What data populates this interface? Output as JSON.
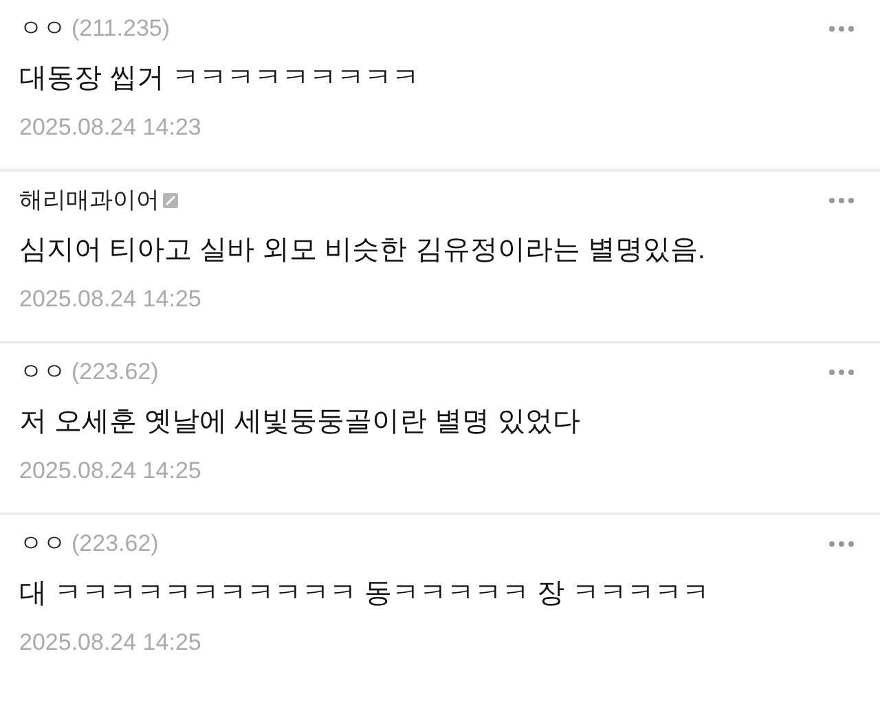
{
  "comments": [
    {
      "author": "ㅇㅇ",
      "ip": "(211.235)",
      "member_icon": false,
      "text": "대동장 씹거 ㅋㅋㅋㅋㅋㅋㅋㅋㅋ",
      "time": "2025.08.24 14:23"
    },
    {
      "author": "해리매과이어",
      "member_icon": true,
      "text": "심지어 티아고 실바 외모 비슷한 김유정이라는 별명있음.",
      "time": "2025.08.24 14:25"
    },
    {
      "author": "ㅇㅇ",
      "ip": "(223.62)",
      "member_icon": false,
      "text": "저 오세훈 옛날에 세빛둥둥골이란 별명 있었다",
      "time": "2025.08.24 14:25"
    },
    {
      "author": "ㅇㅇ",
      "ip": "(223.62)",
      "member_icon": false,
      "text": "대 ㅋㅋㅋㅋㅋㅋㅋㅋㅋㅋㅋ 동ㅋㅋㅋㅋㅋ 장 ㅋㅋㅋㅋㅋ",
      "time": "2025.08.24 14:25"
    }
  ]
}
